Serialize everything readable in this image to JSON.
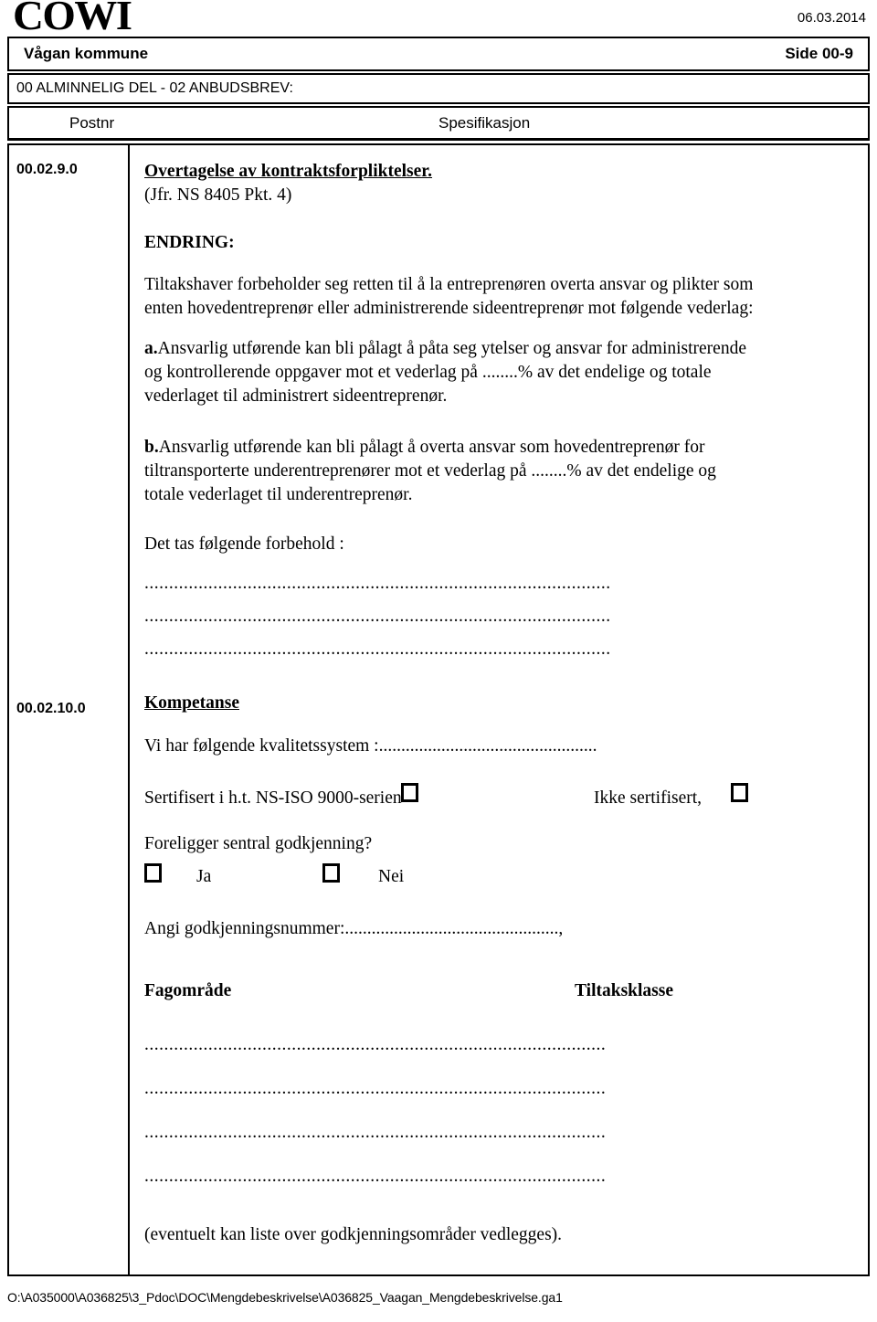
{
  "masthead": {
    "logo_text": "COWI",
    "date": "06.03.2014"
  },
  "header": {
    "company": "Vågan kommune",
    "page_label": "Side 00-9",
    "section_line": "00 ALMINNELIG DEL  -  02 ANBUDSBREV:",
    "column_postnr": "Postnr",
    "column_spesifikasjon": "Spesifikasjon"
  },
  "entries": [
    {
      "postnr": "00.02.9.0",
      "title": "Overtagelse av kontraktsforpliktelser.",
      "reference": "(Jfr. NS 8405 Pkt. 4)",
      "change_label": "ENDRING:",
      "intro": "Tiltakshaver forbeholder seg retten til å la entreprenøren overta ansvar og plikter som enten hovedentreprenør eller administrerende sideentreprenør mot følgende vederlag:",
      "item_a_marker": "a.",
      "item_a_text": "Ansvarlig utførende kan bli pålagt å påta seg ytelser og ansvar for administrerende og kontrollerende oppgaver mot et vederlag på ........% av det endelige og totale vederlaget til administrert sideentreprenør.",
      "item_b_marker": "b.",
      "item_b_text": "Ansvarlig utførende kan bli pålagt å overta ansvar som hovedentreprenør for tiltransporterte underentreprenører mot et vederlag på ........% av det endelige og totale vederlaget til underentreprenør.",
      "reservation_label": "Det tas følgende forbehold :",
      "reservation_lines": [
        "...............................................................................................",
        "...............................................................................................",
        "..............................................................................................."
      ]
    },
    {
      "postnr": "00.02.10.0",
      "title": "Kompetanse",
      "quality_system_label": "Vi har følgende kvalitetssystem :",
      "quality_system_dots": "...............................................",
      "quality_system_tail": "..",
      "certified_label": "Sertifisert i h.t. NS-ISO 9000-serien",
      "not_certified_label": "Ikke sertifisert,",
      "central_approval_question": "Foreligger sentral godkjenning?",
      "yes_label": "Ja",
      "no_label": "Nei",
      "approval_number_label": "Angi godkjenningsnummer:",
      "approval_number_dots": "................................................,",
      "field_heading": "Fagområde",
      "class_heading": "Tiltaksklasse",
      "field_lines": [
        "..............................................................................................",
        "..............................................................................................",
        "..............................................................................................",
        ".............................................................................................."
      ],
      "note": "(eventuelt kan liste over godkjenningsområder vedlegges)."
    }
  ],
  "footer": {
    "path": "O:\\A035000\\A036825\\3_Pdoc\\DOC\\Mengdebeskrivelse\\A036825_Vaagan_Mengdebeskrivelse.ga1"
  }
}
